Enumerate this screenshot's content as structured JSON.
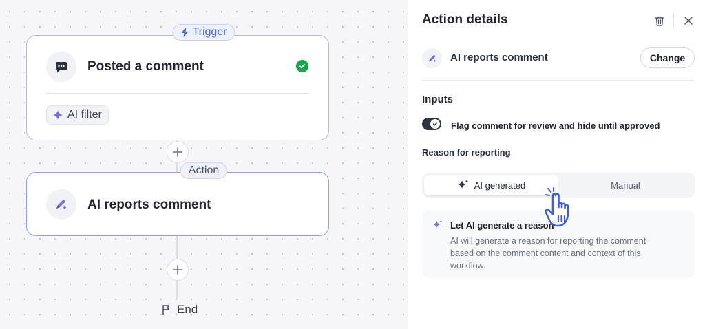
{
  "canvas": {
    "trigger": {
      "pill_label": "Trigger",
      "title": "Posted a comment",
      "filter_label": "AI filter"
    },
    "action": {
      "pill_label": "Action",
      "title": "AI reports comment"
    },
    "end_label": "End"
  },
  "panel": {
    "title": "Action details",
    "action_name": "AI reports comment",
    "change_label": "Change",
    "inputs_label": "Inputs",
    "toggle": {
      "label": "Flag comment for review and hide until approved",
      "on": true
    },
    "reason_label": "Reason for reporting",
    "segments": [
      {
        "label": "AI generated",
        "selected": true
      },
      {
        "label": "Manual",
        "selected": false
      }
    ],
    "info": {
      "title": "Let AI generate a reason",
      "body": "AI will generate a reason for reporting the comment based on the comment content and context of this workflow."
    }
  },
  "colors": {
    "accent": "#4766d8",
    "success": "#16a34a",
    "ai_purple": "#7b6ce0",
    "cursor_blue": "#3f5fd8"
  },
  "icons": [
    "bolt-icon",
    "comment-icon",
    "check-icon",
    "sparkle-icon",
    "ai-flag-icon",
    "plus-icon",
    "flag-icon",
    "trash-icon",
    "close-icon",
    "hand-cursor-icon"
  ]
}
